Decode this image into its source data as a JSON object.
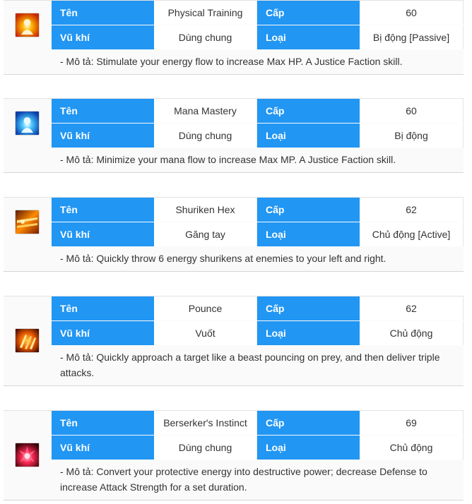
{
  "skills": [
    {
      "icon": "physical-training-icon",
      "name_label": "Tên",
      "name": "Physical Training",
      "level_label": "Cấp",
      "level": "60",
      "weapon_label": "Vũ khí",
      "weapon": "Dùng chung",
      "type_label": "Loại",
      "type": "Bị động [Passive]",
      "description": "- Mô tả: Stimulate your energy flow to increase Max HP. A Justice Faction skill."
    },
    {
      "icon": "mana-mastery-icon",
      "name_label": "Tên",
      "name": "Mana Mastery",
      "level_label": "Cấp",
      "level": "60",
      "weapon_label": "Vũ khí",
      "weapon": "Dùng chung",
      "type_label": "Loại",
      "type": "Bị động",
      "description": "- Mô tả: Minimize your mana flow to increase Max MP. A Justice Faction skill."
    },
    {
      "icon": "shuriken-hex-icon",
      "name_label": "Tên",
      "name": "Shuriken Hex",
      "level_label": "Cấp",
      "level": "62",
      "weapon_label": "Vũ khí",
      "weapon": "Găng tay",
      "type_label": "Loại",
      "type": "Chủ động [Active]",
      "description": "- Mô tả: Quickly throw 6 energy shurikens at enemies to your left and right."
    },
    {
      "icon": "pounce-icon",
      "name_label": "Tên",
      "name": "Pounce",
      "level_label": "Cấp",
      "level": "62",
      "weapon_label": "Vũ khí",
      "weapon": "Vuốt",
      "type_label": "Loại",
      "type": "Chủ động",
      "description": "- Mô tả: Quickly approach a target like a beast pouncing on prey, and then deliver triple attacks."
    },
    {
      "icon": "berserkers-instinct-icon",
      "name_label": "Tên",
      "name": "Berserker's Instinct",
      "level_label": "Cấp",
      "level": "69",
      "weapon_label": "Vũ khí",
      "weapon": "Dùng chung",
      "type_label": "Loại",
      "type": "Chủ động",
      "description": "- Mô tả: Convert your protective energy into destructive power; decrease Defense to increase Attack Strength for a set duration."
    }
  ]
}
